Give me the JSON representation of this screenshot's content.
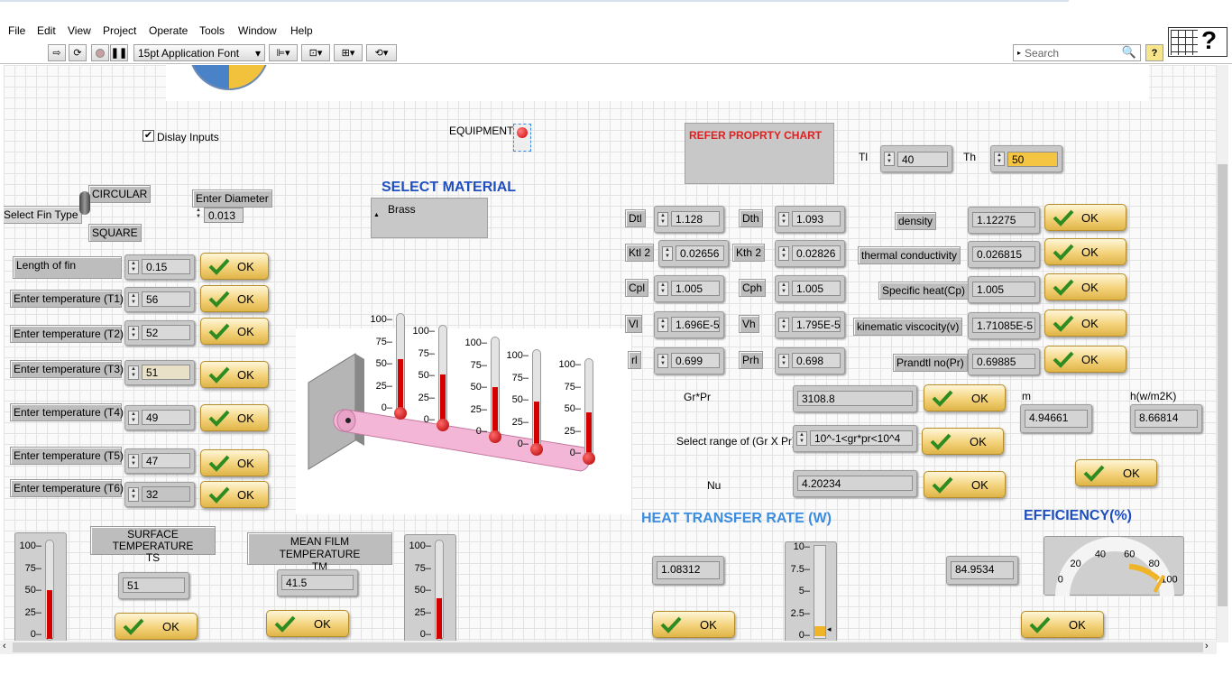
{
  "menu": [
    "File",
    "Edit",
    "View",
    "Project",
    "Operate",
    "Tools",
    "Window",
    "Help"
  ],
  "toolbar": {
    "font_select": "15pt Application Font",
    "search_placeholder": "Search"
  },
  "display_inputs": {
    "label": "Dislay Inputs",
    "checked": true
  },
  "equipment_label": "EQUIPMENT",
  "refer_chart": "REFER PROPRTY CHART",
  "tl": {
    "label": "Tl",
    "value": "40"
  },
  "th": {
    "label": "Th",
    "value": "50"
  },
  "fin_type": {
    "circular": "CIRCULAR",
    "select": "Select Fin Type",
    "square": "SQUARE"
  },
  "diameter": {
    "label": "Enter Diameter",
    "value": "0.013"
  },
  "material": {
    "heading": "SELECT MATERIAL",
    "value": "Brass"
  },
  "inputs": [
    {
      "label": "Length of fin",
      "value": "0.15",
      "ok": "OK"
    },
    {
      "label": "Enter temperature (T1)",
      "value": "56",
      "ok": "OK"
    },
    {
      "label": "Enter temperature (T2)",
      "value": "52",
      "ok": "OK"
    },
    {
      "label": "Enter temperature (T3)",
      "value": "51",
      "ok": "OK"
    },
    {
      "label": "Enter temperature (T4)",
      "value": "49",
      "ok": "OK"
    },
    {
      "label": "Enter temperature (T5)",
      "value": "47",
      "ok": "OK"
    },
    {
      "label": "Enter temperature (T6)",
      "value": "32",
      "ok": "OK"
    }
  ],
  "props_left": [
    {
      "label": "Dtl",
      "value": "1.128"
    },
    {
      "label": "Ktl 2",
      "value": "0.02656"
    },
    {
      "label": "Cpl",
      "value": "1.005"
    },
    {
      "label": "Vl",
      "value": "1.696E-5"
    },
    {
      "label": "rl",
      "value": "0.699"
    }
  ],
  "props_mid": [
    {
      "label": "Dth",
      "value": "1.093"
    },
    {
      "label": "Kth 2",
      "value": "0.02826"
    },
    {
      "label": "Cph",
      "value": "1.005"
    },
    {
      "label": "Vh",
      "value": "1.795E-5"
    },
    {
      "label": "Prh",
      "value": "0.698"
    }
  ],
  "props_right": [
    {
      "label": "density",
      "value": "1.12275",
      "ok": "OK"
    },
    {
      "label": "thermal conductivity",
      "value": "0.026815",
      "ok": "OK"
    },
    {
      "label": "Specific heat(Cp)",
      "value": "1.005",
      "ok": "OK"
    },
    {
      "label": "kinematic viscocity(v)",
      "value": "1.71085E-5",
      "ok": "OK"
    },
    {
      "label": "Prandtl no(Pr)",
      "value": "0.69885",
      "ok": "OK"
    }
  ],
  "grpr": {
    "label": "Gr*Pr",
    "value": "3108.8",
    "ok": "OK"
  },
  "range": {
    "label": "Select range of (Gr X Pr)",
    "value": "10^-1<gr*pr<10^4",
    "ok": "OK"
  },
  "nu": {
    "label": "Nu",
    "value": "4.20234",
    "ok": "OK"
  },
  "m": {
    "label": "m",
    "value": "4.94661"
  },
  "h": {
    "label": "h(w/m2K)",
    "value": "8.66814",
    "ok": "OK"
  },
  "surface_temp": {
    "label": "SURFACE TEMPERATURE\nTS",
    "value": "51",
    "ok": "OK",
    "level": 51
  },
  "mean_temp": {
    "label": "MEAN FILM TEMPERATURE\nTM",
    "value": "41.5",
    "ok": "OK",
    "level": 41.5
  },
  "heat_rate": {
    "heading": "HEAT TRANSFER RATE (W)",
    "value": "1.08312",
    "ok": "OK",
    "level": 1.08312
  },
  "efficiency": {
    "heading": "EFFICIENCY(%)",
    "value": "84.9534",
    "ok": "OK",
    "level": 84.9534
  },
  "fin_therms": [
    56,
    52,
    51,
    49,
    47
  ],
  "therm_ticks": [
    "100",
    "75",
    "50",
    "25",
    "0"
  ],
  "heat_ticks": [
    "10",
    "7.5",
    "5",
    "2.5",
    "0"
  ],
  "gauge_ticks": [
    "0",
    "20",
    "40",
    "60",
    "80",
    "100"
  ],
  "colors": {
    "heading_blue": "#1f4fbf",
    "refer_red": "#e02020",
    "ok_gold": "#f3d27a",
    "mercury": "#d40000"
  }
}
